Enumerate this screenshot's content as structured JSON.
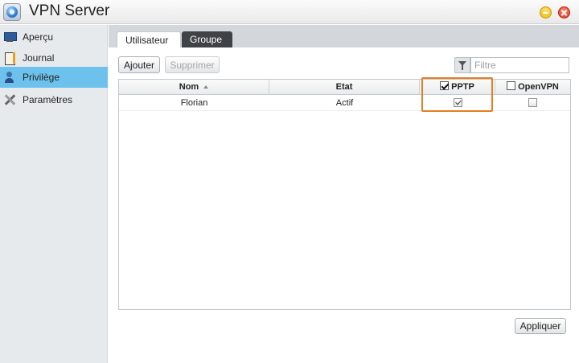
{
  "window": {
    "title": "VPN Server"
  },
  "sidebar": {
    "items": [
      {
        "label": "Aperçu",
        "icon": "monitor-icon"
      },
      {
        "label": "Journal",
        "icon": "journal-icon"
      },
      {
        "label": "Privilège",
        "icon": "user-icon",
        "active": true
      },
      {
        "label": "Paramètres",
        "icon": "tools-icon"
      }
    ]
  },
  "tabs": [
    {
      "label": "Utilisateur",
      "active": true
    },
    {
      "label": "Groupe",
      "active": false
    }
  ],
  "toolbar": {
    "add_label": "Ajouter",
    "delete_label": "Supprimer",
    "filter_placeholder": "Filtre"
  },
  "grid": {
    "columns": [
      {
        "label": "Nom",
        "sorted": "asc"
      },
      {
        "label": "Etat"
      },
      {
        "label": "PPTP",
        "checkbox_checked": true
      },
      {
        "label": "OpenVPN",
        "checkbox_checked": false
      }
    ],
    "rows": [
      {
        "name": "Florian",
        "state": "Actif",
        "pptp": true,
        "openvpn": false
      }
    ]
  },
  "footer": {
    "apply_label": "Appliquer"
  },
  "colors": {
    "accent": "#6cc2ec",
    "highlight": "#e67e22",
    "tab_inactive": "#3f4246"
  }
}
